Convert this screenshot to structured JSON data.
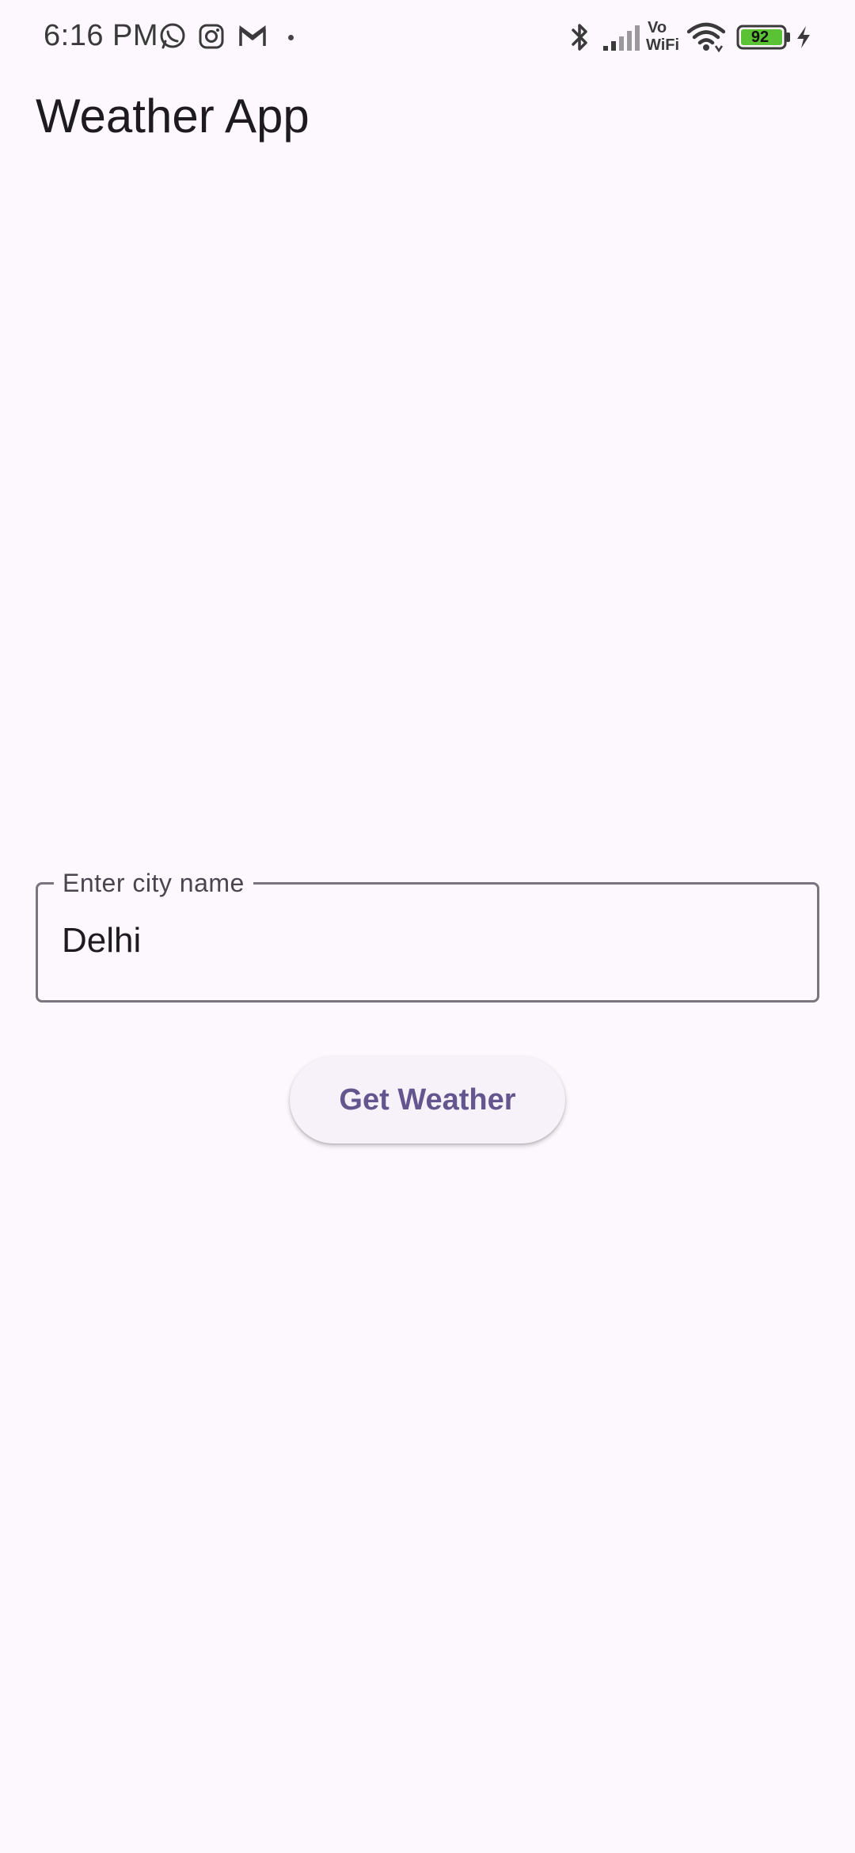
{
  "status_bar": {
    "time": "6:16 PM",
    "battery_level": "92",
    "network_label_top": "Vo",
    "network_label_bottom": "WiFi",
    "icons": [
      "whatsapp-icon",
      "instagram-icon",
      "gmail-icon",
      "notification-dot",
      "bluetooth-icon",
      "cellular-signal-icon",
      "vowifi-icon",
      "wifi-icon",
      "battery-icon",
      "charging-icon"
    ],
    "battery_color": "#5BC236"
  },
  "app_bar": {
    "title": "Weather App"
  },
  "city_input": {
    "label": "Enter city name",
    "value": "Delhi"
  },
  "actions": {
    "get_weather_label": "Get Weather"
  },
  "colors": {
    "background": "#FDF7FE",
    "primary": "#65558F",
    "outline": "#79747E"
  }
}
